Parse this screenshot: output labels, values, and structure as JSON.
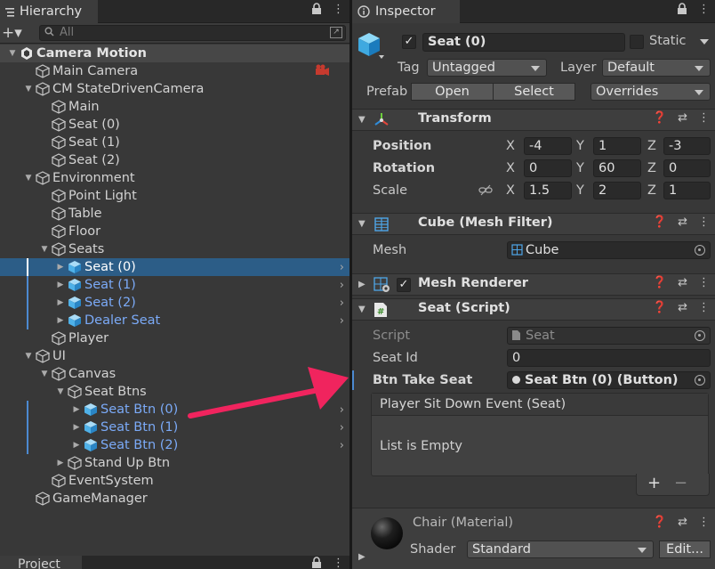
{
  "hierarchy": {
    "tab_title": "Hierarchy",
    "search_placeholder": "All",
    "add_label": "+▾",
    "items": [
      {
        "label": "Camera Motion"
      },
      {
        "label": "Main Camera"
      },
      {
        "label": "CM StateDrivenCamera"
      },
      {
        "label": "Main"
      },
      {
        "label": "Seat (0)"
      },
      {
        "label": "Seat (1)"
      },
      {
        "label": "Seat (2)"
      },
      {
        "label": "Environment"
      },
      {
        "label": "Point Light"
      },
      {
        "label": "Table"
      },
      {
        "label": "Floor"
      },
      {
        "label": "Seats"
      },
      {
        "label": "Seat (0)"
      },
      {
        "label": "Seat (1)"
      },
      {
        "label": "Seat (2)"
      },
      {
        "label": "Dealer Seat"
      },
      {
        "label": "Player"
      },
      {
        "label": "UI"
      },
      {
        "label": "Canvas"
      },
      {
        "label": "Seat Btns"
      },
      {
        "label": "Seat Btn (0)"
      },
      {
        "label": "Seat Btn (1)"
      },
      {
        "label": "Seat Btn (2)"
      },
      {
        "label": "Stand Up Btn"
      },
      {
        "label": "EventSystem"
      },
      {
        "label": "GameManager"
      }
    ]
  },
  "project": {
    "tab_title": "Project"
  },
  "inspector": {
    "tab_title": "Inspector",
    "object_name": "Seat (0)",
    "static_label": "Static",
    "tag_label": "Tag",
    "tag_value": "Untagged",
    "layer_label": "Layer",
    "layer_value": "Default",
    "prefab_label": "Prefab",
    "open_label": "Open",
    "select_label": "Select",
    "overrides_label": "Overrides",
    "transform": {
      "title": "Transform",
      "position_label": "Position",
      "rotation_label": "Rotation",
      "scale_label": "Scale",
      "x": "X",
      "y": "Y",
      "z": "Z",
      "position": [
        "-4",
        "1",
        "-3"
      ],
      "rotation": [
        "0",
        "60",
        "0"
      ],
      "scale": [
        "1.5",
        "2",
        "1"
      ]
    },
    "mesh_filter": {
      "title": "Cube (Mesh Filter)",
      "mesh_label": "Mesh",
      "mesh_value": "Cube"
    },
    "mesh_renderer": {
      "title": "Mesh Renderer"
    },
    "seat_script": {
      "title": "Seat (Script)",
      "script_label": "Script",
      "script_value": "Seat",
      "seat_id_label": "Seat Id",
      "seat_id_value": "0",
      "btn_label": "Btn Take Seat",
      "btn_value": "Seat Btn (0) (Button)",
      "event_title": "Player Sit Down Event (Seat)",
      "event_empty": "List is Empty",
      "plus": "+",
      "minus": "−"
    },
    "material": {
      "title": "Chair (Material)",
      "shader_label": "Shader",
      "shader_value": "Standard",
      "edit_label": "Edit..."
    }
  },
  "colors": {
    "arrow": "#f0245e",
    "prefab_text": "#7baaf7",
    "selection": "#2c5d87"
  }
}
